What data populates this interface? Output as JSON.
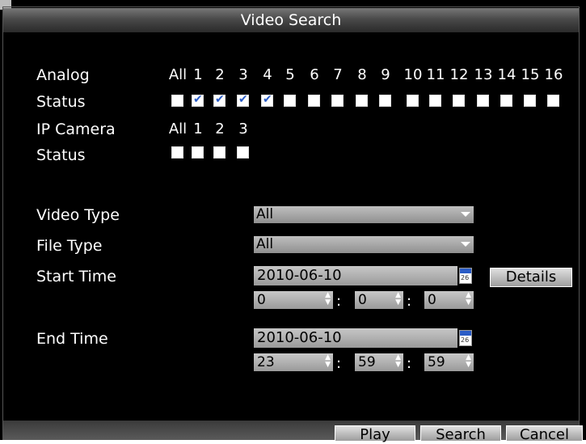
{
  "window": {
    "title": "Video Search"
  },
  "analog": {
    "label": "Analog",
    "status_label": "Status",
    "channels": [
      "All",
      "1",
      "2",
      "3",
      "4",
      "5",
      "6",
      "7",
      "8",
      "9",
      "10",
      "11",
      "12",
      "13",
      "14",
      "15",
      "16"
    ],
    "checked": [
      false,
      true,
      true,
      true,
      true,
      false,
      false,
      false,
      false,
      false,
      false,
      false,
      false,
      false,
      false,
      false,
      false
    ]
  },
  "ip_camera": {
    "label": "IP Camera",
    "status_label": "Status",
    "channels": [
      "All",
      "1",
      "2",
      "3"
    ],
    "checked": [
      false,
      false,
      false,
      false
    ]
  },
  "video_type": {
    "label": "Video Type",
    "value": "All"
  },
  "file_type": {
    "label": "File Type",
    "value": "All"
  },
  "start_time": {
    "label": "Start Time",
    "date": "2010-06-10",
    "hour": "0",
    "minute": "0",
    "second": "0"
  },
  "end_time": {
    "label": "End Time",
    "date": "2010-06-10",
    "hour": "23",
    "minute": "59",
    "second": "59"
  },
  "buttons": {
    "details": "Details",
    "play": "Play",
    "search": "Search",
    "cancel": "Cancel"
  },
  "colors": {
    "background": "#000000",
    "titlebar": "#4a4a4a",
    "check": "#2a5cc6"
  },
  "icons": {
    "dropdown": "chevron-down-icon",
    "calendar": "calendar-icon",
    "spinner": "spinner-icon"
  },
  "calendar_day": "26"
}
